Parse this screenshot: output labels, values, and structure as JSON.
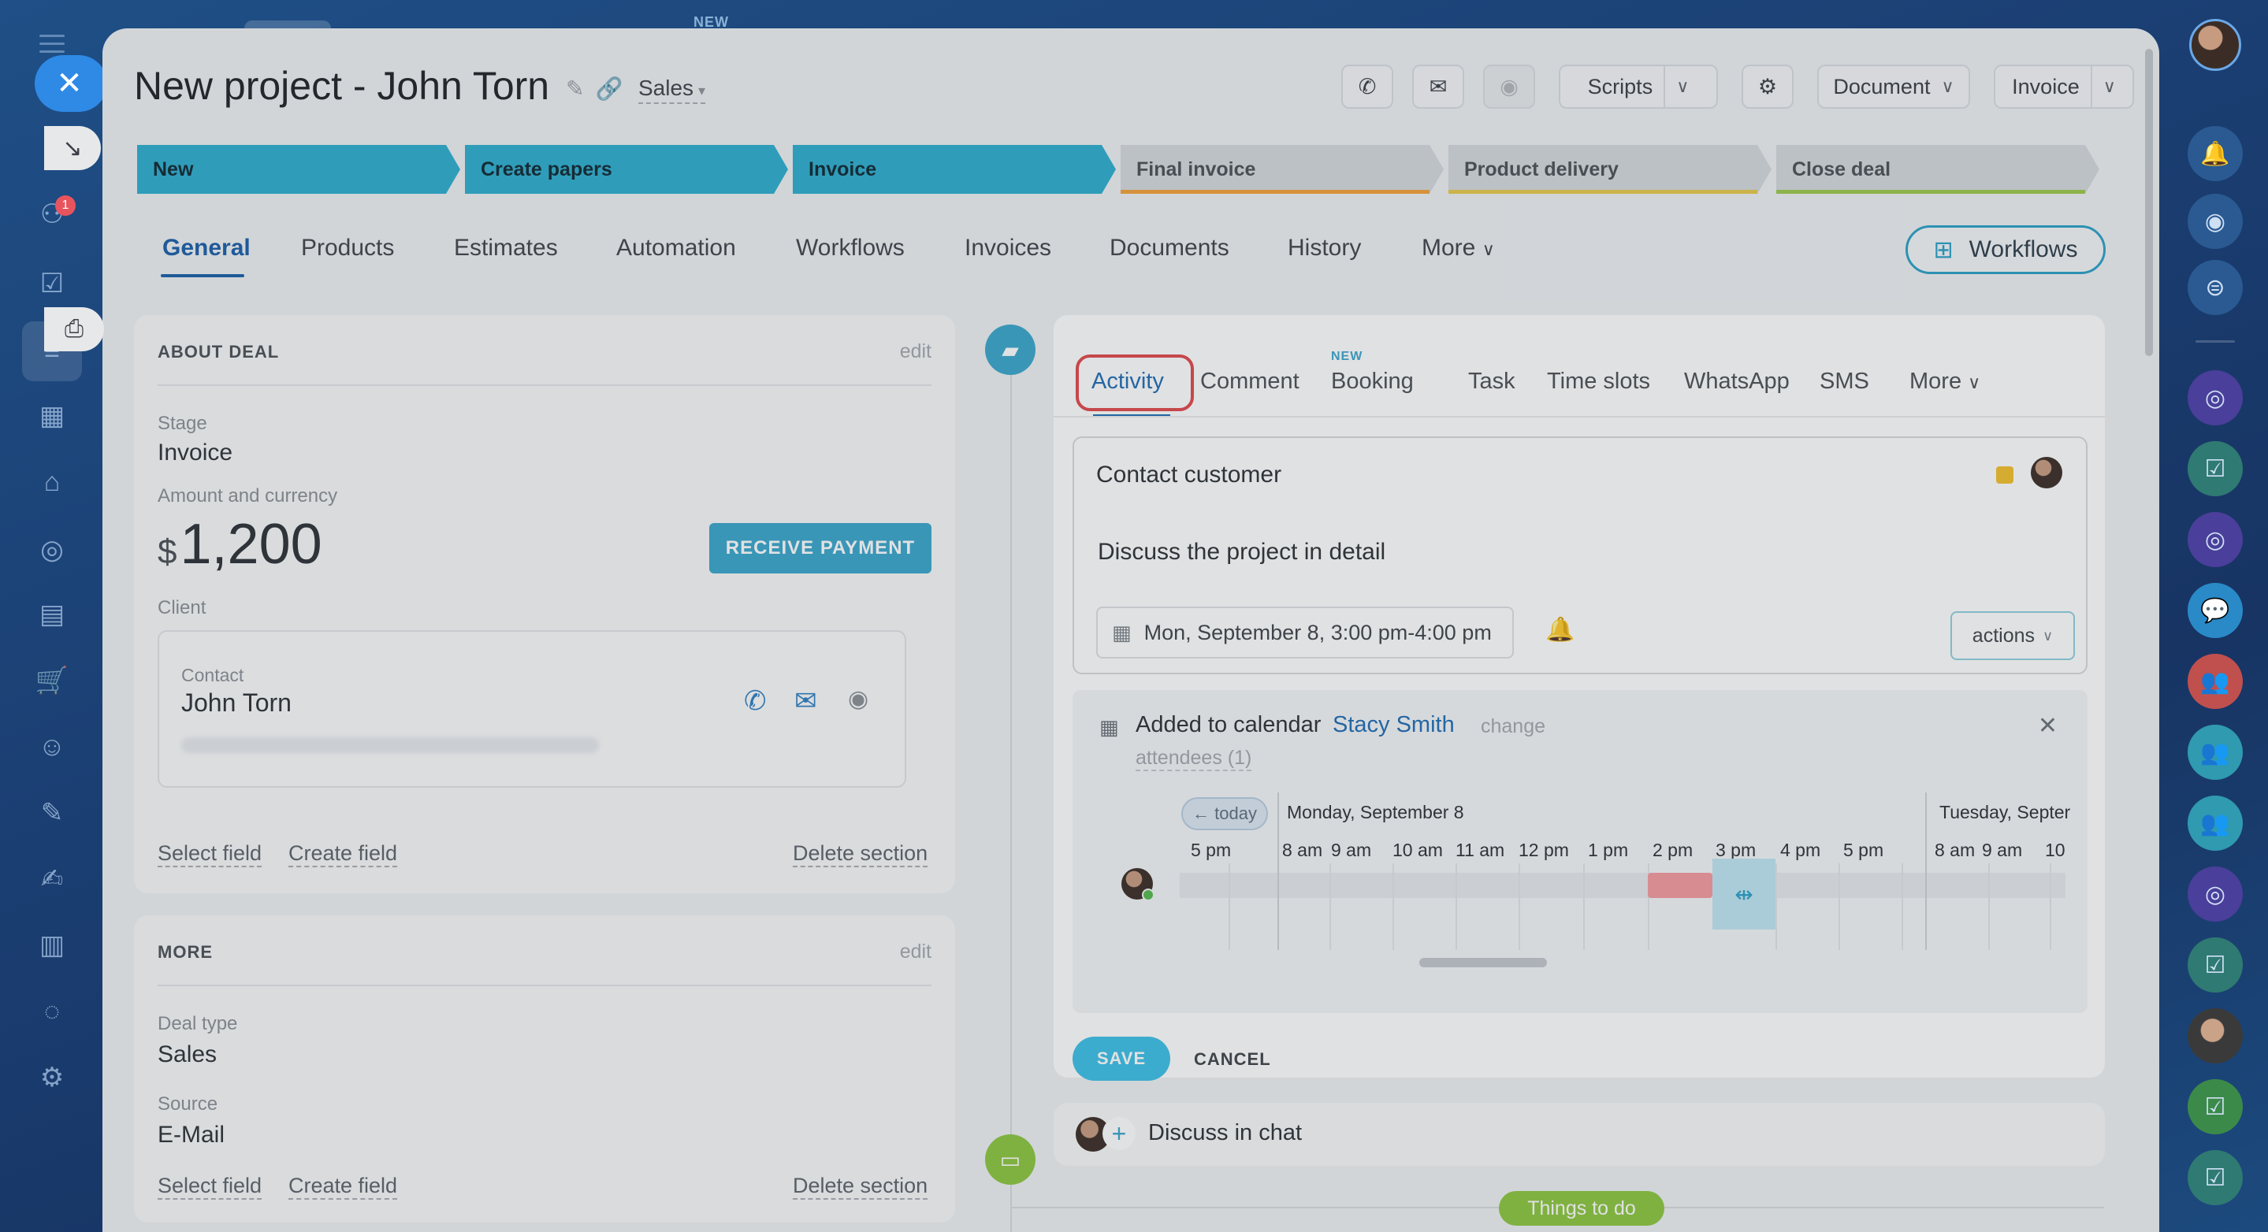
{
  "background": {
    "new_label": "NEW"
  },
  "left_sidebar": {
    "badge_count": "1",
    "icons": [
      "menu-icon",
      "close-icon",
      "collapse-icon",
      "flow-icon",
      "task-icon",
      "crm-icon",
      "calendar-icon",
      "store-icon",
      "target-icon",
      "chat-icon",
      "cart-icon",
      "robot-icon",
      "document-icon",
      "sign-icon",
      "chart-icon",
      "settings-icon"
    ]
  },
  "header": {
    "title": "New project - John Torn",
    "category": "Sales",
    "scripts_label": "Scripts",
    "document_label": "Document",
    "invoice_label": "Invoice"
  },
  "stages": [
    {
      "label": "New",
      "status": "done"
    },
    {
      "label": "Create papers",
      "status": "done"
    },
    {
      "label": "Invoice",
      "status": "done"
    },
    {
      "label": "Final invoice",
      "status": "todo",
      "color": "#f2a13a"
    },
    {
      "label": "Product delivery",
      "status": "todo",
      "color": "#e8c94a"
    },
    {
      "label": "Close deal",
      "status": "todo",
      "color": "#9cc94a"
    }
  ],
  "tabs": [
    "General",
    "Products",
    "Estimates",
    "Automation",
    "Workflows",
    "Invoices",
    "Documents",
    "History",
    "More"
  ],
  "workflows_button": "Workflows",
  "about_deal": {
    "heading": "ABOUT DEAL",
    "edit": "edit",
    "stage_label": "Stage",
    "stage_value": "Invoice",
    "amount_label": "Amount and currency",
    "currency": "$",
    "amount": "1,200",
    "receive_payment": "RECEIVE PAYMENT",
    "client_label": "Client",
    "contact_label": "Contact",
    "contact_name": "John Torn",
    "select_field": "Select field",
    "create_field": "Create field",
    "delete_section": "Delete section"
  },
  "more_section": {
    "heading": "MORE",
    "edit": "edit",
    "deal_type_label": "Deal type",
    "deal_type_value": "Sales",
    "source_label": "Source",
    "source_value": "E-Mail",
    "select_field": "Select field",
    "create_field": "Create field",
    "delete_section": "Delete section"
  },
  "activity": {
    "tabs": [
      "Activity",
      "Comment",
      "Booking",
      "Task",
      "Time slots",
      "WhatsApp",
      "SMS",
      "More"
    ],
    "new_tag": "NEW",
    "title": "Contact customer",
    "description": "Discuss the project in detail",
    "datetime": "Mon, September 8, 3:00 pm-4:00 pm",
    "actions": "actions",
    "calendar": {
      "added_label": "Added to calendar",
      "user": "Stacy Smith",
      "change": "change",
      "attendees": "attendees (1)",
      "today": "← today",
      "day1": "Monday, September 8",
      "day2": "Tuesday, Septer",
      "hours_prev": [
        "5 pm"
      ],
      "hours_day1": [
        "8 am",
        "9 am",
        "10 am",
        "11 am",
        "12 pm",
        "1 pm",
        "2 pm",
        "3 pm",
        "4 pm",
        "5 pm"
      ],
      "hours_day2": [
        "8 am",
        "9 am",
        "10"
      ]
    },
    "save": "SAVE",
    "cancel": "CANCEL"
  },
  "chat": {
    "text": "Discuss in chat"
  },
  "things_to_do": "Things to do",
  "colors": {
    "accent": "#2daed0",
    "brand_blue": "#1f6db4",
    "danger": "#e0484c",
    "save": "#3bc0e8"
  }
}
